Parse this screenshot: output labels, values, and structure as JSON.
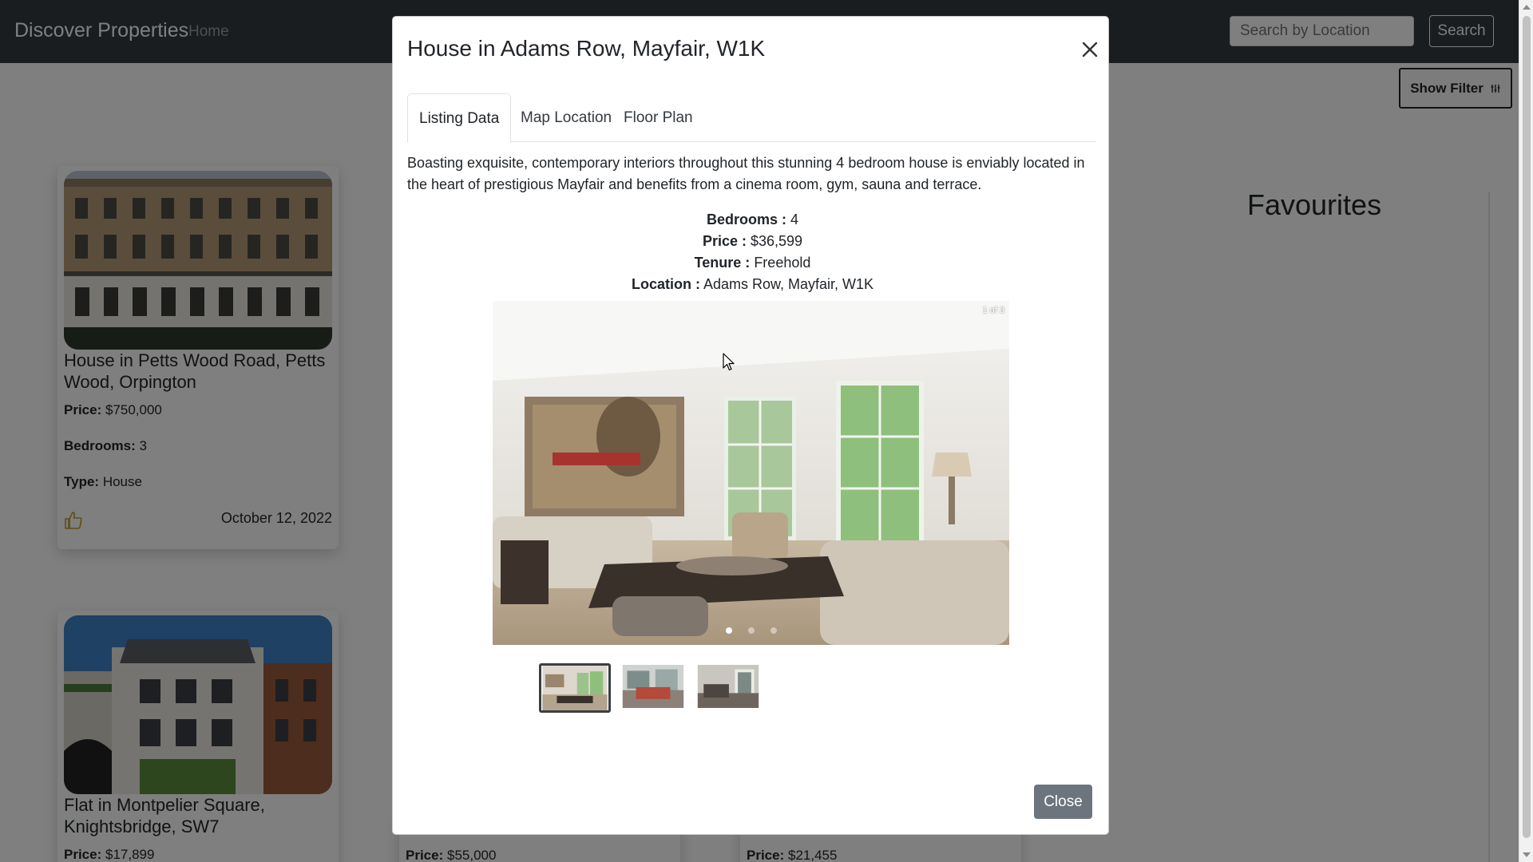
{
  "navbar": {
    "brand": "Discover Properties",
    "home_link": "Home",
    "search_placeholder": "Search by Location",
    "search_button": "Search"
  },
  "filter_button": "Show Filter",
  "favourites_title": "Favourites",
  "cards": [
    {
      "title": "House in Petts Wood Road, Petts Wood, Orpington",
      "price_label": "Price:",
      "price": "$750,000",
      "bedrooms_label": "Bedrooms:",
      "bedrooms": "3",
      "type_label": "Type:",
      "type": "House",
      "date": "October 12, 2022",
      "icon": "thumbs-up-icon"
    },
    {
      "title": "Flat in Montpelier Square, Knightsbridge, SW7",
      "price_label": "Price:",
      "price": "$17,899"
    }
  ],
  "peek_cards": [
    {
      "price_label": "Price:",
      "price": "$55,000"
    },
    {
      "price_label": "Price:",
      "price": "$21,455"
    }
  ],
  "modal": {
    "title": "House in Adams Row, Mayfair, W1K",
    "tabs": [
      "Listing Data",
      "Map Location",
      "Floor Plan"
    ],
    "active_tab": "Listing Data",
    "description": "Boasting exquisite, contemporary interiors throughout this stunning 4 bedroom house is enviably located in the heart of prestigious Mayfair and benefits from a cinema room, gym, sauna and terrace.",
    "details": [
      {
        "label": "Bedrooms :",
        "value": "4"
      },
      {
        "label": "Price :",
        "value": "$36,599"
      },
      {
        "label": "Tenure :",
        "value": "Freehold"
      },
      {
        "label": "Location :",
        "value": "Adams Row, Mayfair, W1K"
      }
    ],
    "carousel": {
      "counter": "1 of 3",
      "slides": 3,
      "current": 1
    },
    "close_button": "Close"
  },
  "colors": {
    "navbar_bg": "#343a40",
    "close_button_bg": "#6c757d"
  }
}
